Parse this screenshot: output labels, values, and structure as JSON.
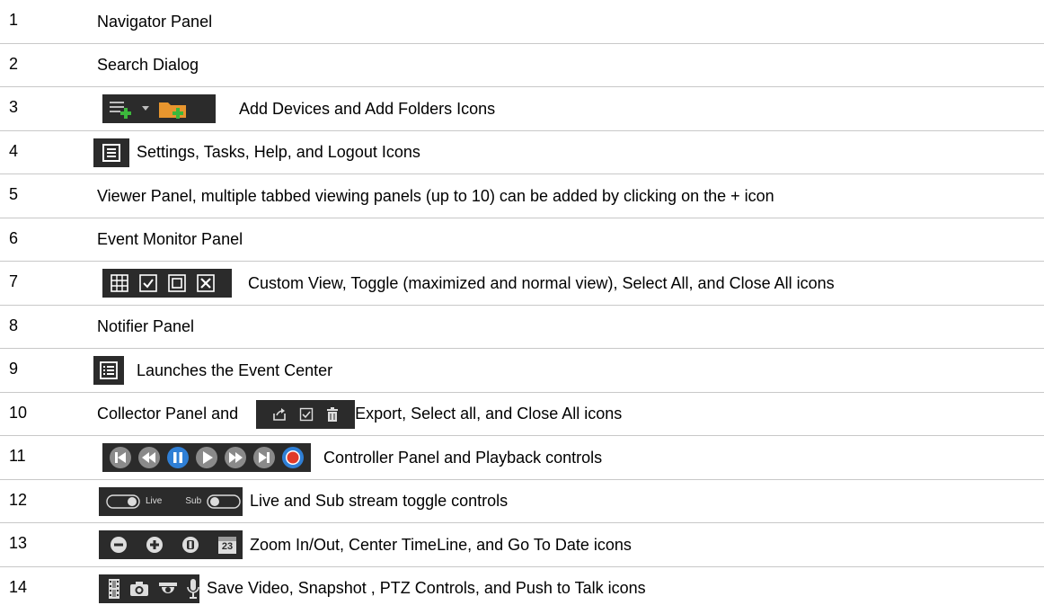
{
  "rows": [
    {
      "num": "1",
      "text": "Navigator Panel"
    },
    {
      "num": "2",
      "text": "Search Dialog"
    },
    {
      "num": "3",
      "text": "Add Devices and Add Folders Icons"
    },
    {
      "num": "4",
      "text": "Settings, Tasks, Help, and Logout Icons"
    },
    {
      "num": "5",
      "text": "Viewer Panel, multiple tabbed viewing panels (up to 10) can be added by clicking on the + icon"
    },
    {
      "num": "6",
      "text": "Event Monitor Panel"
    },
    {
      "num": "7",
      "text": "Custom View, Toggle (maximized and normal view), Select All, and Close All icons"
    },
    {
      "num": "8",
      "text": "Notifier Panel"
    },
    {
      "num": "9",
      "text": "Launches the Event Center"
    },
    {
      "num": "10",
      "text_before": "Collector Panel and",
      "text": "Export, Select all, and Close All icons"
    },
    {
      "num": "11",
      "text": "Controller Panel and Playback controls"
    },
    {
      "num": "12",
      "text": "Live and Sub stream toggle controls",
      "live_label": "Live",
      "sub_label": "Sub"
    },
    {
      "num": "13",
      "text": "Zoom In/Out, Center TimeLine, and Go To Date icons",
      "calendar_day": "23"
    },
    {
      "num": "14",
      "text": "Save Video, Snapshot , PTZ Controls, and Push to Talk icons"
    }
  ],
  "icons": {
    "row3": [
      "add-device-icon",
      "dropdown-arrow-icon",
      "add-folder-icon"
    ],
    "row4": [
      "menu-list-icon"
    ],
    "row7": [
      "custom-view-grid-icon",
      "select-all-check-icon",
      "toggle-maximize-icon",
      "close-all-icon"
    ],
    "row9": [
      "event-center-list-icon"
    ],
    "row10": [
      "export-icon",
      "select-all-check-icon",
      "trash-icon"
    ],
    "row11": [
      "skip-start-icon",
      "rewind-icon",
      "pause-icon",
      "play-icon",
      "fast-forward-icon",
      "skip-end-icon",
      "record-icon"
    ],
    "row12": [
      "live-toggle-icon",
      "sub-toggle-icon"
    ],
    "row13": [
      "zoom-out-icon",
      "zoom-in-icon",
      "center-timeline-icon",
      "calendar-icon"
    ],
    "row14": [
      "film-strip-icon",
      "camera-icon",
      "ptz-dome-icon",
      "microphone-icon"
    ]
  },
  "colors": {
    "accent_green": "#3cb83c",
    "folder_orange": "#e8962e",
    "record_red": "#e03a2a",
    "pause_blue": "#2f7fd6",
    "dark_bg": "#2b2b2b"
  }
}
